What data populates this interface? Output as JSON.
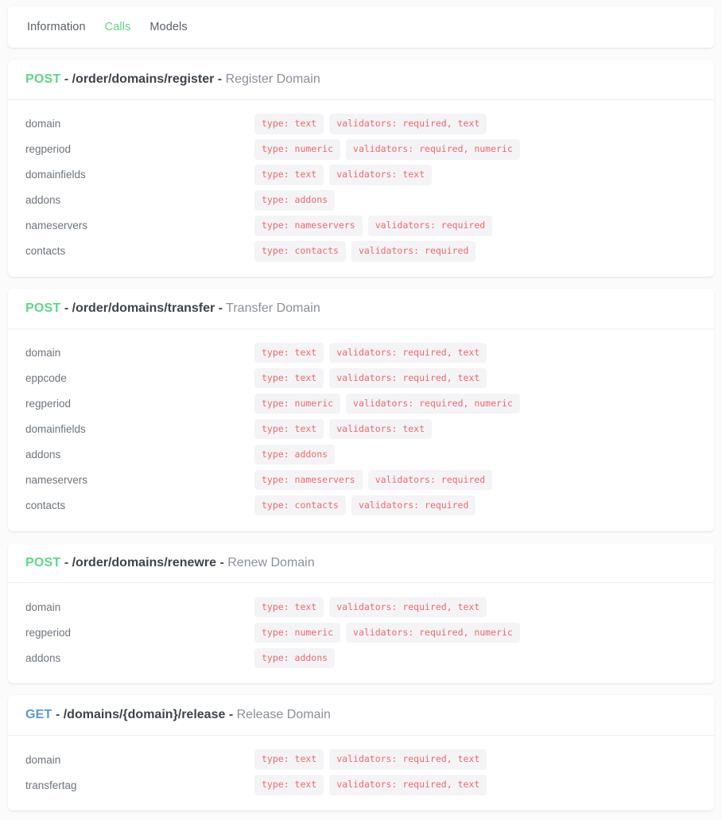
{
  "colors": {
    "page_background": "#fbfbfc",
    "card_background": "#ffffff",
    "method_post": "#5fd788",
    "method_get": "#5b9bd5",
    "tab_active": "#5fd788",
    "tab_inactive": "#5a6169",
    "badge_background": "#f4f4f6",
    "badge_text": "#f2666e",
    "path_text": "#3f444b",
    "description_text": "#8a9099",
    "param_name_text": "#6e757d",
    "divider": "#eeeff1"
  },
  "tabs": [
    {
      "label": "Information",
      "active": false
    },
    {
      "label": "Calls",
      "active": true
    },
    {
      "label": "Models",
      "active": false
    }
  ],
  "endpoints": [
    {
      "method": "POST",
      "separator": "-",
      "path": "/order/domains/register",
      "description": "Register Domain",
      "params": [
        {
          "name": "domain",
          "badges": [
            "type: text",
            "validators: required, text"
          ]
        },
        {
          "name": "regperiod",
          "badges": [
            "type: numeric",
            "validators: required, numeric"
          ]
        },
        {
          "name": "domainfields",
          "badges": [
            "type: text",
            "validators: text"
          ]
        },
        {
          "name": "addons",
          "badges": [
            "type: addons"
          ]
        },
        {
          "name": "nameservers",
          "badges": [
            "type: nameservers",
            "validators: required"
          ]
        },
        {
          "name": "contacts",
          "badges": [
            "type: contacts",
            "validators: required"
          ]
        }
      ]
    },
    {
      "method": "POST",
      "separator": "-",
      "path": "/order/domains/transfer",
      "description": "Transfer Domain",
      "params": [
        {
          "name": "domain",
          "badges": [
            "type: text",
            "validators: required, text"
          ]
        },
        {
          "name": "eppcode",
          "badges": [
            "type: text",
            "validators: required, text"
          ]
        },
        {
          "name": "regperiod",
          "badges": [
            "type: numeric",
            "validators: required, numeric"
          ]
        },
        {
          "name": "domainfields",
          "badges": [
            "type: text",
            "validators: text"
          ]
        },
        {
          "name": "addons",
          "badges": [
            "type: addons"
          ]
        },
        {
          "name": "nameservers",
          "badges": [
            "type: nameservers",
            "validators: required"
          ]
        },
        {
          "name": "contacts",
          "badges": [
            "type: contacts",
            "validators: required"
          ]
        }
      ]
    },
    {
      "method": "POST",
      "separator": "-",
      "path": "/order/domains/renewre",
      "description": "Renew Domain",
      "params": [
        {
          "name": "domain",
          "badges": [
            "type: text",
            "validators: required, text"
          ]
        },
        {
          "name": "regperiod",
          "badges": [
            "type: numeric",
            "validators: required, numeric"
          ]
        },
        {
          "name": "addons",
          "badges": [
            "type: addons"
          ]
        }
      ]
    },
    {
      "method": "GET",
      "separator": "-",
      "path": "/domains/{domain}/release",
      "description": "Release Domain",
      "params": [
        {
          "name": "domain",
          "badges": [
            "type: text",
            "validators: required, text"
          ]
        },
        {
          "name": "transfertag",
          "badges": [
            "type: text",
            "validators: required, text"
          ]
        }
      ]
    }
  ]
}
